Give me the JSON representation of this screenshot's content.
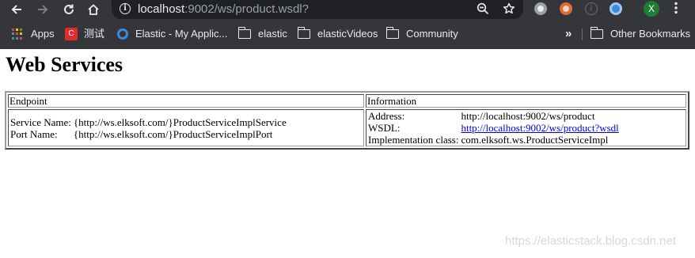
{
  "browser": {
    "url_host": "localhost",
    "url_rest": ":9002/ws/product.wsdl?",
    "profile_initial": "X",
    "bookmarks": [
      {
        "label": "Apps"
      },
      {
        "label": "测试"
      },
      {
        "label": "Elastic - My Applic..."
      },
      {
        "label": "elastic"
      },
      {
        "label": "elasticVideos"
      },
      {
        "label": "Community"
      }
    ],
    "overflow_label": "»",
    "other_bookmarks": "Other Bookmarks",
    "icons": {
      "back": "arrow-left-icon",
      "forward": "arrow-right-icon",
      "reload": "reload-icon",
      "home": "home-icon",
      "info": "info-icon",
      "zoom": "zoom-out-icon",
      "star": "star-icon",
      "menu": "kebab-menu-icon"
    },
    "colors": {
      "frame": "#35363a",
      "omnibox": "#202124",
      "text": "#e8eaed",
      "avatar": "#1e7e34"
    }
  },
  "page": {
    "title": "Web Services",
    "table": {
      "endpoint_header": "Endpoint",
      "information_header": "Information",
      "service_name_label": "Service Name:",
      "service_name_value": "{http://ws.elksoft.com/}ProductServiceImplService",
      "port_name_label": "Port Name:",
      "port_name_value": "{http://ws.elksoft.com/}ProductServiceImplPort",
      "address_label": "Address:",
      "address_value": "http://localhost:9002/ws/product",
      "wsdl_label": "WSDL:",
      "wsdl_value": "http://localhost:9002/ws/product?wsdl",
      "impl_label": "Implementation class:",
      "impl_value": "com.elksoft.ws.ProductServiceImpl"
    },
    "watermark": "https://elasticstack.blog.csdn.net"
  }
}
